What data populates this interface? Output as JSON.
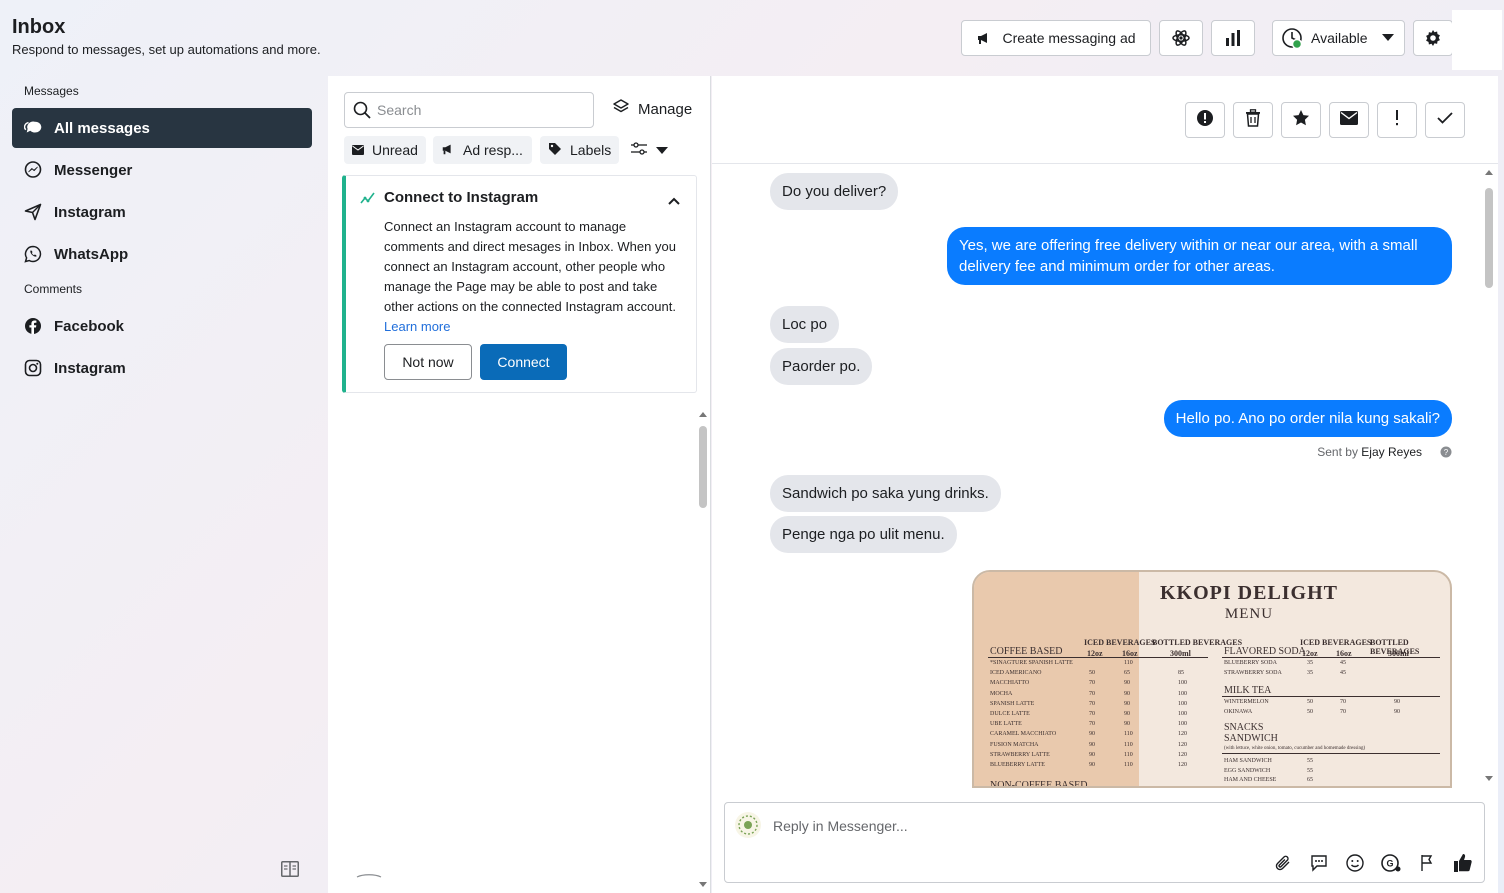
{
  "header": {
    "title": "Inbox",
    "subtitle": "Respond to messages, set up automations and more.",
    "create_ad_label": "Create messaging ad",
    "status_label": "Available"
  },
  "nav": {
    "messages_section": "Messages",
    "comments_section": "Comments",
    "items": [
      {
        "label": "All messages",
        "icon": "chat-bubbles-icon",
        "active": true
      },
      {
        "label": "Messenger",
        "icon": "messenger-icon"
      },
      {
        "label": "Instagram",
        "icon": "instagram-direct-icon"
      },
      {
        "label": "WhatsApp",
        "icon": "whatsapp-icon"
      }
    ],
    "comment_items": [
      {
        "label": "Facebook",
        "icon": "facebook-icon"
      },
      {
        "label": "Instagram",
        "icon": "instagram-icon"
      }
    ]
  },
  "list": {
    "search_placeholder": "Search",
    "manage_label": "Manage",
    "filters": {
      "unread": "Unread",
      "ad": "Ad resp...",
      "labels": "Labels"
    },
    "card": {
      "title": "Connect to Instagram",
      "body": "Connect an Instagram account to manage comments and direct mesages in Inbox. When you connect an Instagram account, other people who manage the Page may be able to post and take other actions on the connected Instagram account.",
      "learn_more": "Learn more",
      "not_now": "Not now",
      "connect": "Connect"
    }
  },
  "conversation": {
    "messages": [
      {
        "dir": "in",
        "text": "Do you deliver?"
      },
      {
        "dir": "out",
        "text": "Yes, we are offering free delivery within or near our area, with a small delivery fee and minimum order for other areas."
      },
      {
        "dir": "in",
        "text": "Loc po"
      },
      {
        "dir": "in",
        "text": "Paorder po."
      },
      {
        "dir": "out",
        "text": "Hello po. Ano po order nila kung sakali?"
      },
      {
        "dir": "in",
        "text": "Sandwich po saka yung drinks."
      },
      {
        "dir": "in",
        "text": "Penge nga po ulit menu."
      }
    ],
    "sent_by_prefix": "Sent by",
    "sent_by_name": "Ejay Reyes",
    "reply_placeholder": "Reply in Messenger..."
  },
  "menu_image": {
    "title": "KKOPI DELIGHT",
    "subtitle": "MENU",
    "col_iced": "ICED BEVERAGES",
    "col_bottled": "BOTTLED BEVERAGES",
    "size_12": "12oz",
    "size_16": "16oz",
    "size_300": "300ml",
    "coffee_section": "COFFEE BASED",
    "noncoffee_section": "NON-COFFEE BASED",
    "soda_section": "FLAVORED SODA",
    "milktea_section": "MILK TEA",
    "snacks_section": "SNACKS",
    "sandwich_section": "SANDWICH",
    "sandwich_note": "(with lettuce, white onion, tomato, cucumber and homemade dressing)",
    "coffee_rows": [
      {
        "name": "*SINAGTURE SPANISH LATTE",
        "a": "",
        "b": "110",
        "c": ""
      },
      {
        "name": "ICED AMERICANO",
        "a": "50",
        "b": "65",
        "c": "85"
      },
      {
        "name": "MACCHIATTO",
        "a": "70",
        "b": "90",
        "c": "100"
      },
      {
        "name": "MOCHA",
        "a": "70",
        "b": "90",
        "c": "100"
      },
      {
        "name": "SPANISH LATTE",
        "a": "70",
        "b": "90",
        "c": "100"
      },
      {
        "name": "DULCE LATTE",
        "a": "70",
        "b": "90",
        "c": "100"
      },
      {
        "name": "UBE LATTE",
        "a": "70",
        "b": "90",
        "c": "100"
      },
      {
        "name": "CARAMEL MACCHIATO",
        "a": "90",
        "b": "110",
        "c": "120"
      },
      {
        "name": "FUSION MATCHA",
        "a": "90",
        "b": "110",
        "c": "120"
      },
      {
        "name": "STRAWBERRY LATTE",
        "a": "90",
        "b": "110",
        "c": "120"
      },
      {
        "name": "BLUEBERRY LATTE",
        "a": "90",
        "b": "110",
        "c": "120"
      }
    ],
    "soda_rows": [
      {
        "name": "BLUEBERRY SODA",
        "a": "35",
        "b": "45"
      },
      {
        "name": "STRAWBERRY SODA",
        "a": "35",
        "b": "45"
      }
    ],
    "milktea_rows": [
      {
        "name": "WINTERMELON",
        "a": "50",
        "b": "70",
        "c": "90"
      },
      {
        "name": "OKINAWA",
        "a": "50",
        "b": "70",
        "c": "90"
      }
    ],
    "sandwich_rows": [
      {
        "name": "HAM SANDWICH",
        "price": "55"
      },
      {
        "name": "EGG SANDWICH",
        "price": "55"
      },
      {
        "name": "HAM AND CHEESE",
        "price": "65"
      }
    ]
  },
  "colors": {
    "accent": "#0a7cff",
    "nav_active": "#283541",
    "connect_button": "#0a6bb8",
    "card_border": "#20b28d"
  }
}
